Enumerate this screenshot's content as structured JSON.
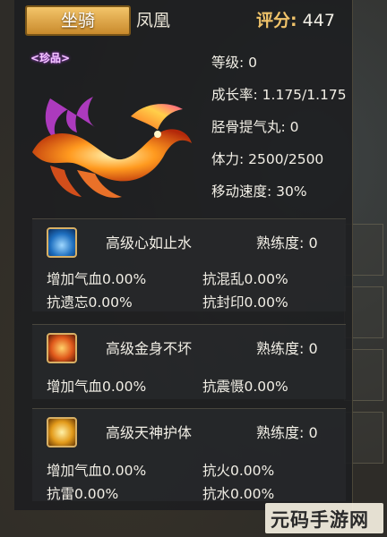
{
  "header": {
    "tab_mount": "坐骑",
    "tab_phoenix": "凤凰",
    "score_label": "评分:",
    "score_value": "447"
  },
  "mount": {
    "rarity": "<珍品>",
    "stats": [
      {
        "label": "等级:",
        "value": "0"
      },
      {
        "label": "成长率:",
        "value": "1.175/1.175"
      },
      {
        "label": "胫骨提气丸:",
        "value": "0"
      },
      {
        "label": "体力:",
        "value": "2500/2500"
      },
      {
        "label": "移动速度:",
        "value": "30%"
      }
    ]
  },
  "skills": [
    {
      "name": "高级心如止水",
      "proficiency": "熟练度: 0",
      "icon": "water-skill-icon",
      "attrs": [
        "增加气血0.00%",
        "抗混乱0.00%",
        "抗遗忘0.00%",
        "抗封印0.00%"
      ]
    },
    {
      "name": "高级金身不坏",
      "proficiency": "熟练度: 0",
      "icon": "golden-body-skill-icon",
      "attrs": [
        "增加气血0.00%",
        "抗震慑0.00%"
      ]
    },
    {
      "name": "高级天神护体",
      "proficiency": "熟练度: 0",
      "icon": "divine-guard-skill-icon",
      "attrs": [
        "增加气血0.00%",
        "抗火0.00%",
        "抗雷0.00%",
        "抗水0.00%"
      ]
    }
  ],
  "watermark": "元码手游网",
  "colors": {
    "accent_gold": "#f0c36a",
    "rarity_purple": "#f4c8ff",
    "tab_orange": "#d9962f"
  }
}
